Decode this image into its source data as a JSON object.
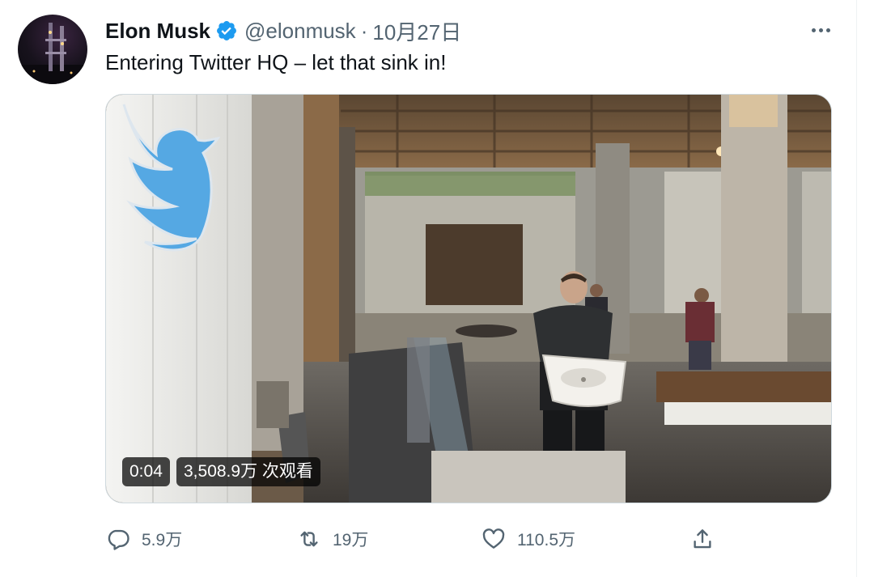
{
  "tweet": {
    "author_name": "Elon Musk",
    "handle": "@elonmusk",
    "separator": "·",
    "date": "10月27日",
    "text": "Entering Twitter HQ – let that sink in!",
    "verified_color": "#1d9bf0"
  },
  "video": {
    "duration": "0:04",
    "views": "3,508.9万 次观看"
  },
  "actions": {
    "reply_count": "5.9万",
    "retweet_count": "19万",
    "like_count": "110.5万"
  },
  "icons": {
    "verified": "verified-badge-icon",
    "more": "more-horizontal-icon",
    "reply": "reply-icon",
    "retweet": "retweet-icon",
    "like": "heart-icon",
    "share": "share-icon"
  },
  "colors": {
    "text_primary": "#0f1419",
    "text_secondary": "#536471",
    "brand_blue": "#1d9bf0",
    "bird_blue": "#55a8e3"
  }
}
